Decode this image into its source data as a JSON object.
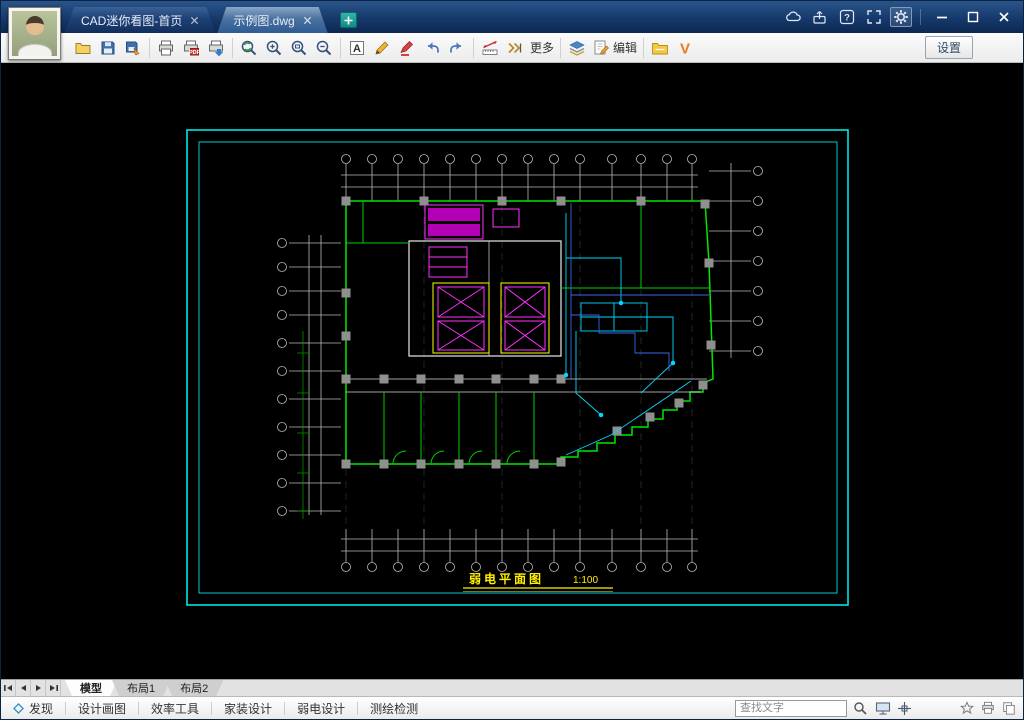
{
  "titlebar": {
    "tabs": [
      {
        "label": "CAD迷你看图-首页"
      },
      {
        "label": "示例图.dwg"
      }
    ]
  },
  "toolbar": {
    "more_label": "更多",
    "edit_label": "编辑",
    "settings_label": "设置"
  },
  "drawing": {
    "title": "弱电平面图",
    "scale": "1:100"
  },
  "layout_tabs": [
    {
      "label": "模型"
    },
    {
      "label": "布局1"
    },
    {
      "label": "布局2"
    }
  ],
  "bottom_bar": {
    "items": [
      {
        "label": "发现"
      },
      {
        "label": "设计画图"
      },
      {
        "label": "效率工具"
      },
      {
        "label": "家装设计"
      },
      {
        "label": "弱电设计"
      },
      {
        "label": "测绘检测"
      }
    ],
    "search_placeholder": "查找文字"
  },
  "colors": {
    "frame_cyan": "#00e5e5",
    "wall_green": "#00e800",
    "equipment_magenta": "#ff30ff",
    "title_yellow": "#ffef00",
    "titlebar_blue": "#16396c"
  }
}
